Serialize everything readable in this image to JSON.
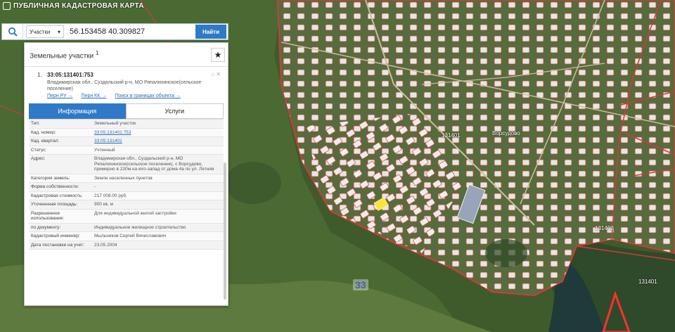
{
  "app": {
    "title": "ПУБЛИЧНАЯ КАДАСТРОВАЯ КАРТА"
  },
  "search": {
    "type_label": "Участки",
    "value": "56.153458 40.309827",
    "find_label": "Найти"
  },
  "panel": {
    "title": "Земельные участки",
    "title_count": "1",
    "result": {
      "number": "1.",
      "cadastral_number": "33:05:131401:753",
      "address": "Владимирская обл., Суздальский р-н, МО Ряпалихинское(сельское поселение)",
      "links": [
        "Перн РУ →",
        "Перн КК →",
        "Поиск в границах объекта →"
      ]
    },
    "tabs": [
      {
        "label": "Информация"
      },
      {
        "label": "Услуги"
      }
    ],
    "info_rows": [
      {
        "label": "Тип:",
        "value": "Земельный участок",
        "is_link": false
      },
      {
        "label": "Кад. номер:",
        "value": "33:05:131401:753",
        "is_link": true
      },
      {
        "label": "Кад. квартал:",
        "value": "33:05:131401",
        "is_link": true
      },
      {
        "label": "Статус:",
        "value": "Учтенный",
        "is_link": false
      },
      {
        "label": "Адрес:",
        "value": "Владимирская обл., Суздальский р-н, МО Ряпалихинское(сельское поселение), с Ворсудово, примерно в 220м на юго-запад от дома 4а по ул. Летняя",
        "is_link": false
      },
      {
        "label": "Категория земель:",
        "value": "Земли населенных пунктов",
        "is_link": false
      },
      {
        "label": "Форма собственности:",
        "value": "-",
        "is_link": false
      },
      {
        "label": "Кадастровая стоимость:",
        "value": "217 008.00 руб.",
        "is_link": false
      },
      {
        "label": "Уточненная площадь:",
        "value": "900 кв. м",
        "is_link": false
      },
      {
        "label": "Разрешенное использование:",
        "value": "Для индивидуальной жилой застройки",
        "is_link": false
      },
      {
        "label": "по документу:",
        "value": "Индивидуальное жилищное строительство",
        "is_link": false
      },
      {
        "label": "Кадастровый инженер:",
        "value": "Мыльников Сергей Вячеславович",
        "is_link": false
      },
      {
        "label": "Дата постановки на учет:",
        "value": "23.05.2004",
        "is_link": false
      }
    ]
  },
  "map": {
    "labels": [
      {
        "text": "131401",
        "pos": "center"
      },
      {
        "text": "Ворсудово",
        "pos": "center-right"
      },
      {
        "text": "131402",
        "pos": "right"
      },
      {
        "text": "131401",
        "pos": "bottom-right"
      },
      {
        "text": "33",
        "pos": "bottom"
      }
    ]
  },
  "colors": {
    "accent": "#2f79c7",
    "boundary": "#d23a3a",
    "selected_parcel": "#f5e63b",
    "link": "#2a6bb5"
  },
  "icons": [
    "search-icon",
    "chevron-down-icon",
    "star-icon"
  ]
}
